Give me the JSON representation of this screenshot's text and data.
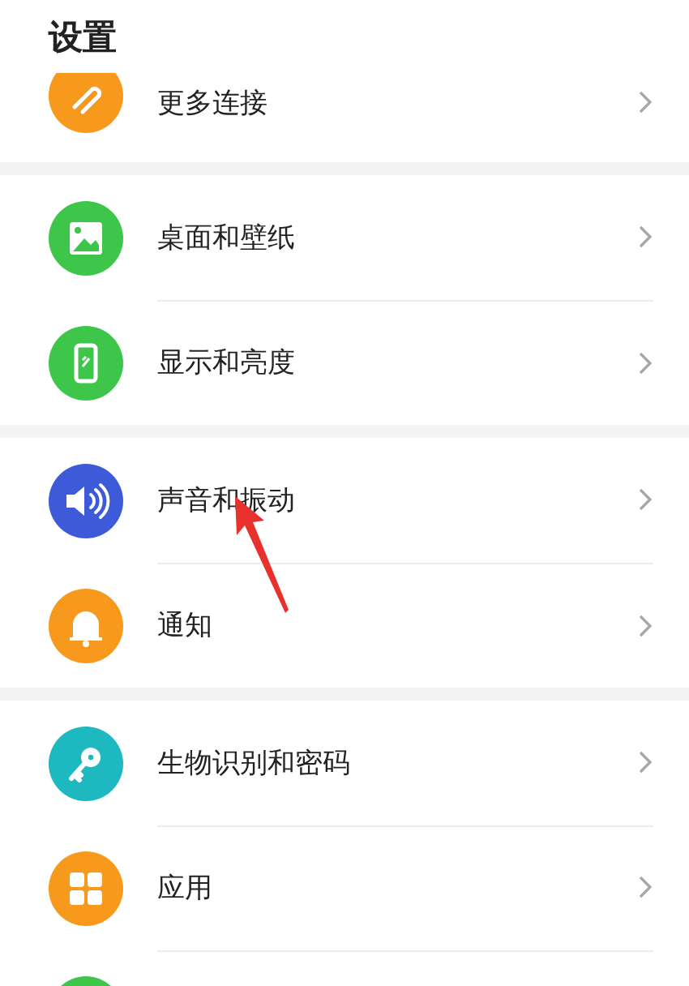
{
  "title": "设置",
  "groups": [
    {
      "items": [
        {
          "label": "更多连接",
          "kind": "link",
          "color": "#f7991c",
          "clipped": true
        }
      ]
    },
    {
      "items": [
        {
          "label": "桌面和壁纸",
          "kind": "image",
          "color": "#3ec64a"
        },
        {
          "label": "显示和亮度",
          "kind": "phone",
          "color": "#3ec64a"
        }
      ]
    },
    {
      "items": [
        {
          "label": "声音和振动",
          "kind": "speaker",
          "color": "#3d5bd9"
        },
        {
          "label": "通知",
          "kind": "bell",
          "color": "#f7991c"
        }
      ]
    },
    {
      "items": [
        {
          "label": "生物识别和密码",
          "kind": "key",
          "color": "#1db8c0"
        },
        {
          "label": "应用",
          "kind": "grid",
          "color": "#f7991c"
        },
        {
          "kind": "blank",
          "color": "#3ec64a"
        }
      ]
    }
  ],
  "annotation_arrow": true
}
